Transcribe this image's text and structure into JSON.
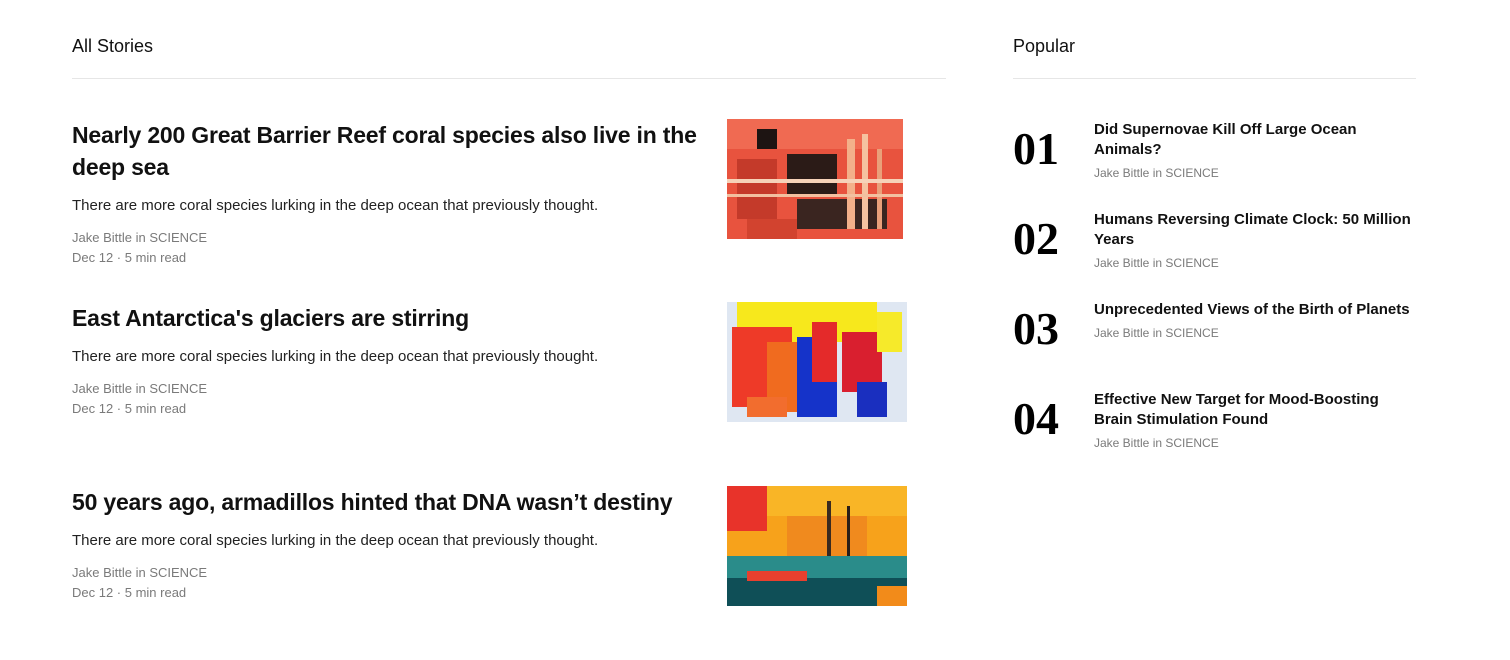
{
  "all_stories": {
    "heading": "All Stories",
    "stories": [
      {
        "title": "Nearly 200 Great Barrier Reef coral species also live in the deep sea",
        "description": "There are more coral species lurking in the deep ocean that previously thought.",
        "byline": "Jake Bittle in SCIENCE",
        "date_read": "Dec 12 · 5 min read",
        "image": "abstract-painting-red-black"
      },
      {
        "title": "East Antarctica's glaciers are stirring",
        "description": "There are more coral species lurking in the deep ocean that previously thought.",
        "byline": "Jake Bittle in SCIENCE",
        "date_read": "Dec 12 · 5 min read",
        "image": "abstract-painting-yellow-red-blue"
      },
      {
        "title": "50 years ago, armadillos hinted that DNA wasn’t destiny",
        "description": "There are more coral species lurking in the deep ocean that previously thought.",
        "byline": "Jake Bittle in SCIENCE",
        "date_read": "Dec 12 · 5 min read",
        "image": "abstract-painting-orange-teal"
      }
    ]
  },
  "popular": {
    "heading": "Popular",
    "items": [
      {
        "number": "01",
        "title": "Did Supernovae Kill Off Large Ocean Animals?",
        "byline": "Jake Bittle in SCIENCE"
      },
      {
        "number": "02",
        "title": "Humans Reversing Climate Clock: 50 Million Years",
        "byline": "Jake Bittle in SCIENCE"
      },
      {
        "number": "03",
        "title": "Unprecedented Views of the Birth of Planets",
        "byline": "Jake Bittle in SCIENCE"
      },
      {
        "number": "04",
        "title": "Effective New Target for Mood-Boosting Brain Stimulation Found",
        "byline": "Jake Bittle in SCIENCE"
      }
    ]
  }
}
